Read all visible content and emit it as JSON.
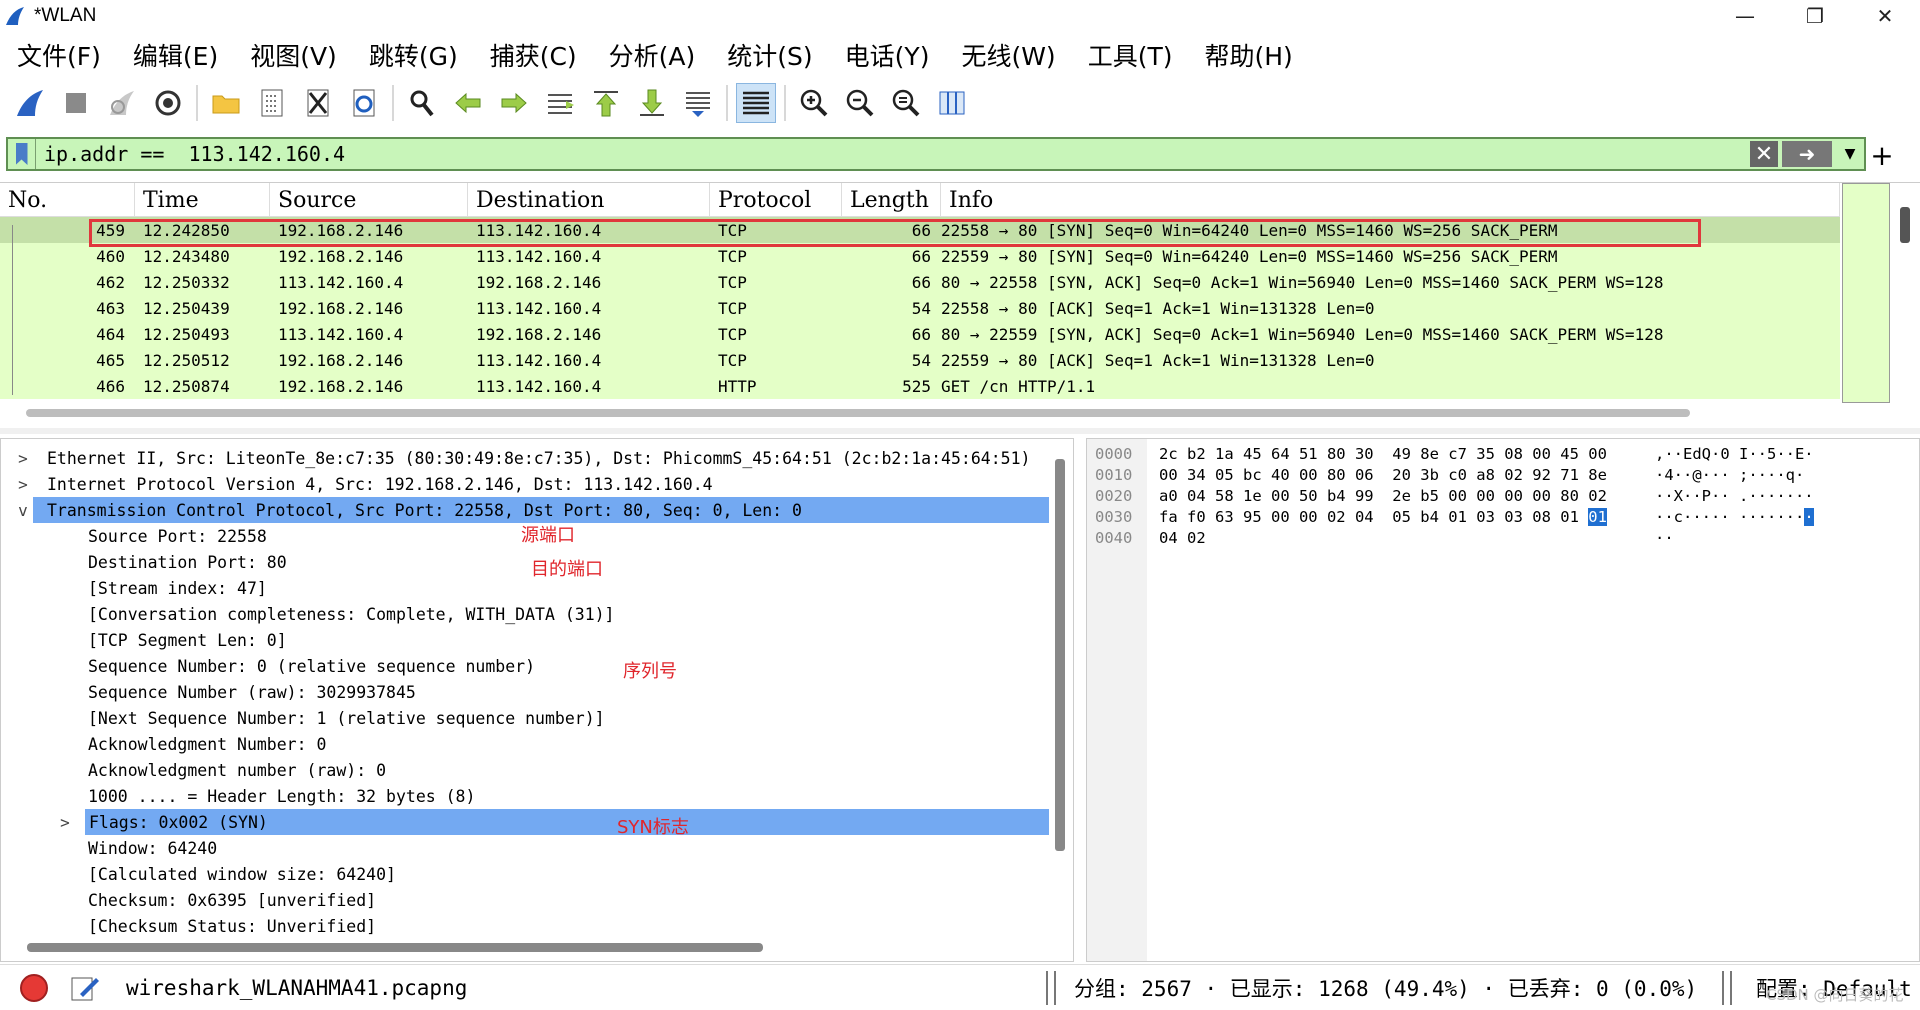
{
  "window": {
    "title": "*WLAN"
  },
  "menu": [
    "文件(F)",
    "编辑(E)",
    "视图(V)",
    "跳转(G)",
    "捕获(C)",
    "分析(A)",
    "统计(S)",
    "电话(Y)",
    "无线(W)",
    "工具(T)",
    "帮助(H)"
  ],
  "filter": {
    "value": "ip.addr ==  113.142.160.4"
  },
  "packet_list": {
    "columns": [
      "No.",
      "Time",
      "Source",
      "Destination",
      "Protocol",
      "Length",
      "Info"
    ],
    "rows": [
      {
        "no": "459",
        "time": "12.242850",
        "src": "192.168.2.146",
        "dst": "113.142.160.4",
        "proto": "TCP",
        "len": "66",
        "info": "22558 → 80 [SYN] Seq=0 Win=64240 Len=0 MSS=1460 WS=256 SACK_PERM"
      },
      {
        "no": "460",
        "time": "12.243480",
        "src": "192.168.2.146",
        "dst": "113.142.160.4",
        "proto": "TCP",
        "len": "66",
        "info": "22559 → 80 [SYN] Seq=0 Win=64240 Len=0 MSS=1460 WS=256 SACK_PERM"
      },
      {
        "no": "462",
        "time": "12.250332",
        "src": "113.142.160.4",
        "dst": "192.168.2.146",
        "proto": "TCP",
        "len": "66",
        "info": "80 → 22558 [SYN, ACK] Seq=0 Ack=1 Win=56940 Len=0 MSS=1460 SACK_PERM WS=128"
      },
      {
        "no": "463",
        "time": "12.250439",
        "src": "192.168.2.146",
        "dst": "113.142.160.4",
        "proto": "TCP",
        "len": "54",
        "info": "22558 → 80 [ACK] Seq=1 Ack=1 Win=131328 Len=0"
      },
      {
        "no": "464",
        "time": "12.250493",
        "src": "113.142.160.4",
        "dst": "192.168.2.146",
        "proto": "TCP",
        "len": "66",
        "info": "80 → 22559 [SYN, ACK] Seq=0 Ack=1 Win=56940 Len=0 MSS=1460 SACK_PERM WS=128"
      },
      {
        "no": "465",
        "time": "12.250512",
        "src": "192.168.2.146",
        "dst": "113.142.160.4",
        "proto": "TCP",
        "len": "54",
        "info": "22559 → 80 [ACK] Seq=1 Ack=1 Win=131328 Len=0"
      },
      {
        "no": "466",
        "time": "12.250874",
        "src": "192.168.2.146",
        "dst": "113.142.160.4",
        "proto": "HTTP",
        "len": "525",
        "info": "GET /cn HTTP/1.1"
      }
    ]
  },
  "details": [
    {
      "text": "Ethernet II, Src: LiteonTe_8e:c7:35 (80:30:49:8e:c7:35), Dst: PhicommS_45:64:51 (2c:b2:1a:45:64:51)",
      "expander": ">"
    },
    {
      "text": "Internet Protocol Version 4, Src: 192.168.2.146, Dst: 113.142.160.4",
      "expander": ">"
    },
    {
      "text": "Transmission Control Protocol, Src Port: 22558, Dst Port: 80, Seq: 0, Len: 0",
      "expander": "v"
    },
    {
      "text": "Source Port: 22558"
    },
    {
      "text": "Destination Port: 80"
    },
    {
      "text": "[Stream index: 47]"
    },
    {
      "text": "[Conversation completeness: Complete, WITH_DATA (31)]"
    },
    {
      "text": "[TCP Segment Len: 0]"
    },
    {
      "text": "Sequence Number: 0    (relative sequence number)"
    },
    {
      "text": "Sequence Number (raw): 3029937845"
    },
    {
      "text": "[Next Sequence Number: 1    (relative sequence number)]"
    },
    {
      "text": "Acknowledgment Number: 0"
    },
    {
      "text": "Acknowledgment number (raw): 0"
    },
    {
      "text": "1000 .... = Header Length: 32 bytes (8)"
    },
    {
      "text": "Flags: 0x002 (SYN)",
      "expander": ">"
    },
    {
      "text": "Window: 64240"
    },
    {
      "text": "[Calculated window size: 64240]"
    },
    {
      "text": "Checksum: 0x6395 [unverified]"
    },
    {
      "text": "[Checksum Status: Unverified]"
    }
  ],
  "annotations": {
    "src_port": "源端口",
    "dst_port": "目的端口",
    "seq": "序列号",
    "syn": "SYN标志"
  },
  "bytes": [
    {
      "off": "0000",
      "hex": "2c b2 1a 45 64 51 80 30  49 8e c7 35 08 00 45 00",
      "asc": ",··EdQ·0 I··5··E·"
    },
    {
      "off": "0010",
      "hex": "00 34 05 bc 40 00 80 06  20 3b c0 a8 02 92 71 8e",
      "asc": "·4··@··· ;····q·"
    },
    {
      "off": "0020",
      "hex": "a0 04 58 1e 00 50 b4 99  2e b5 00 00 00 00 80 02",
      "asc": "··X··P·· .·······"
    },
    {
      "off": "0030",
      "hex_pre": "fa f0 63 95 00 00 02 04  05 b4 01 03 03 08 01 ",
      "hex_sel": "01",
      "asc_pre": "··c····· ·······",
      "asc_sel": "·"
    },
    {
      "off": "0040",
      "hex": "04 02",
      "asc": "··"
    }
  ],
  "status": {
    "file": "wireshark_WLANAHMA41.pcapng",
    "stats": "分组: 2567 · 已显示: 1268 (49.4%) · 已丢弃: 0 (0.0%)",
    "profile": "配置: Default",
    "watermark": "CSDN @向日葵的花"
  }
}
